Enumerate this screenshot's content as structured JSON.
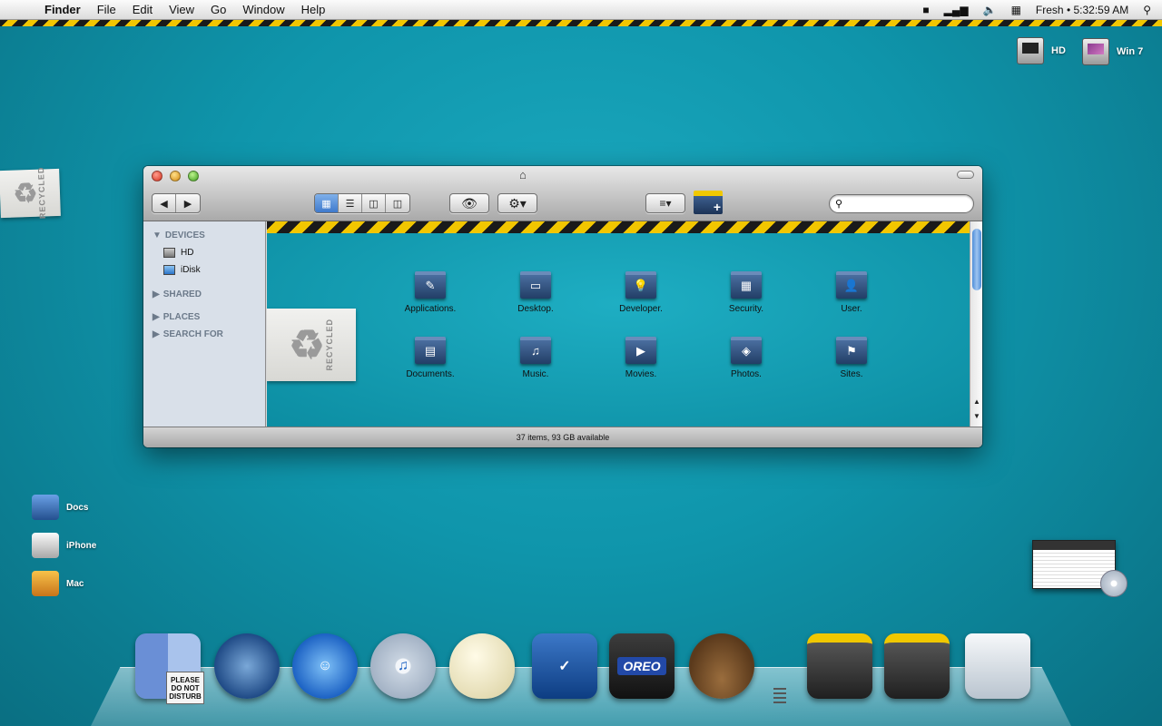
{
  "menubar": {
    "app_name": "Finder",
    "items": [
      "File",
      "Edit",
      "View",
      "Go",
      "Window",
      "Help"
    ],
    "user": "Fresh",
    "clock": "• 5:32:59 AM"
  },
  "desktop": {
    "drives": [
      {
        "label": "HD",
        "icon": "hard-drive-icon"
      },
      {
        "label": "Win 7",
        "icon": "windows-drive-icon"
      }
    ],
    "side_items": [
      {
        "label": "Docs",
        "icon": "blue-robot-icon"
      },
      {
        "label": "iPhone",
        "icon": "white-robot-icon"
      },
      {
        "label": "Mac",
        "icon": "orange-robot-icon"
      }
    ],
    "recycled_tag_text": "RECYCLED"
  },
  "finder": {
    "sidebar": {
      "devices_header": "DEVICES",
      "devices": [
        {
          "label": "HD",
          "icon": "hard-drive-icon"
        },
        {
          "label": "iDisk",
          "icon": "idisk-icon"
        }
      ],
      "shared_header": "SHARED",
      "places_header": "PLACES",
      "search_header": "SEARCH FOR"
    },
    "search_placeholder": "",
    "folders": [
      {
        "label": "Applications.",
        "glyph": "✎"
      },
      {
        "label": "Desktop.",
        "glyph": "▭"
      },
      {
        "label": "Developer.",
        "glyph": "💡"
      },
      {
        "label": "Security.",
        "glyph": "▦"
      },
      {
        "label": "User.",
        "glyph": "👤"
      },
      {
        "label": "Documents.",
        "glyph": "▤"
      },
      {
        "label": "Music.",
        "glyph": "♫"
      },
      {
        "label": "Movies.",
        "glyph": "▶"
      },
      {
        "label": "Photos.",
        "glyph": "◈"
      },
      {
        "label": "Sites.",
        "glyph": "⚑"
      }
    ],
    "status": "37 items, 93 GB available"
  },
  "dock": {
    "items": [
      {
        "name": "finder",
        "icon": "finder-icon"
      },
      {
        "name": "firefox",
        "icon": "firefox-icon"
      },
      {
        "name": "ichat",
        "icon": "ichat-icon"
      },
      {
        "name": "itunes",
        "icon": "itunes-icon"
      },
      {
        "name": "egg",
        "icon": "egg-quill-icon"
      },
      {
        "name": "tasks",
        "icon": "tasks-checkbox-icon"
      },
      {
        "name": "oreo",
        "icon": "oreo-icon",
        "text": "OREO"
      },
      {
        "name": "tweetie",
        "icon": "bird-nest-icon"
      },
      {
        "name": "movies-stack",
        "icon": "clapboard-icon"
      },
      {
        "name": "downloads-stack",
        "icon": "clapboard-icon"
      },
      {
        "name": "trash",
        "icon": "trash-icon"
      }
    ],
    "dnd_text": "PLEASE DO NOT DISTURB"
  }
}
